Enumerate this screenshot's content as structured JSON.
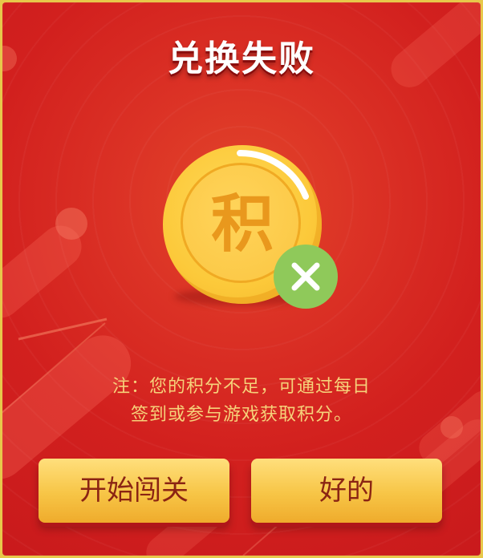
{
  "dialog": {
    "title": "兑换失败",
    "coin": {
      "character": "积",
      "status_icon": "close-icon"
    },
    "note_line1": "注：您的积分不足，可通过每日",
    "note_line2": "签到或参与游戏获取积分。",
    "buttons": {
      "start_label": "开始闯关",
      "ok_label": "好的"
    }
  },
  "colors": {
    "background_red": "#d2201e",
    "border_gold": "#e7c84a",
    "coin_gold": "#fcc93a",
    "badge_green": "#8fc95a",
    "button_text": "#8b2413",
    "note_text": "#f6d27a"
  }
}
